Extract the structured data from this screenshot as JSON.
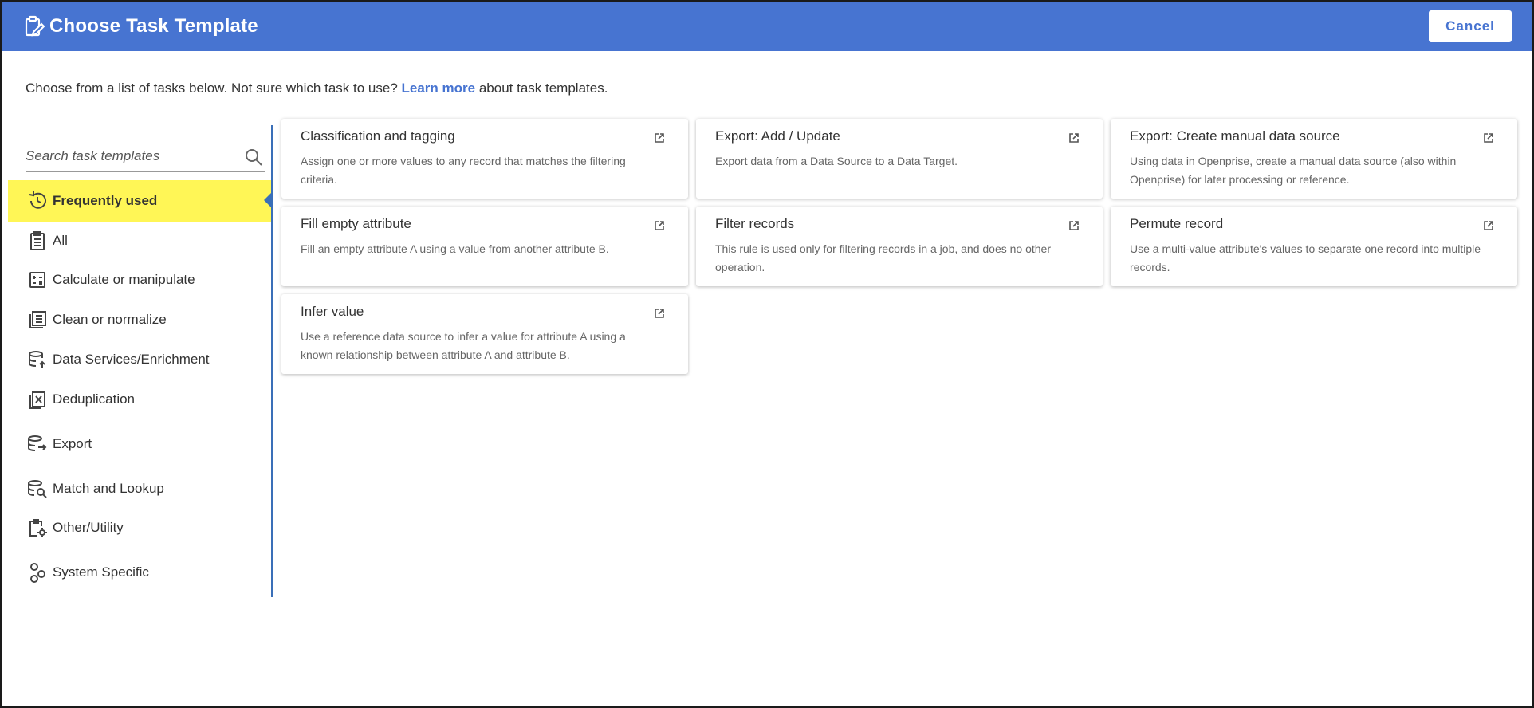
{
  "header": {
    "title": "Choose Task Template",
    "cancel_label": "Cancel"
  },
  "intro": {
    "before_link": "Choose from a list of tasks below. Not sure which task to use?",
    "link": "Learn more",
    "after_link": "about task templates."
  },
  "search": {
    "placeholder": "Search task templates"
  },
  "categories": [
    {
      "label": "Frequently used",
      "icon": "history-icon"
    },
    {
      "label": "All",
      "icon": "clipboard-list-icon"
    },
    {
      "label": "Calculate or manipulate",
      "icon": "calculator-icon"
    },
    {
      "label": "Clean or normalize",
      "icon": "list-clean-icon"
    },
    {
      "label": "Data Services/Enrichment",
      "icon": "database-upload-icon"
    },
    {
      "label": "Deduplication",
      "icon": "dedup-icon"
    },
    {
      "label": "Export",
      "icon": "database-export-icon"
    },
    {
      "label": "Match and Lookup",
      "icon": "database-search-icon"
    },
    {
      "label": "Other/Utility",
      "icon": "clipboard-gear-icon"
    },
    {
      "label": "System Specific",
      "icon": "nodes-icon"
    }
  ],
  "cards": [
    {
      "title": "Classification and tagging",
      "description": "Assign one or more values to any record that matches the filtering criteria."
    },
    {
      "title": "Export: Add / Update",
      "description": "Export data from a Data Source to a Data Target."
    },
    {
      "title": "Export: Create manual data source",
      "description": "Using data in Openprise, create a manual data source (also within Openprise) for later processing or reference."
    },
    {
      "title": "Fill empty attribute",
      "description": "Fill an empty attribute A using a value from another attribute B."
    },
    {
      "title": "Filter records",
      "description": "This rule is used only for filtering records in a job, and does no other operation."
    },
    {
      "title": "Permute record",
      "description": "Use a multi-value attribute's values to separate one record into multiple records."
    },
    {
      "title": "Infer value",
      "description": "Use a reference data source to infer a value for attribute A using a known relationship between attribute A and attribute B."
    }
  ],
  "colors": {
    "header": "#4774d1",
    "active": "#fff656",
    "accent": "#3a6fb8"
  }
}
